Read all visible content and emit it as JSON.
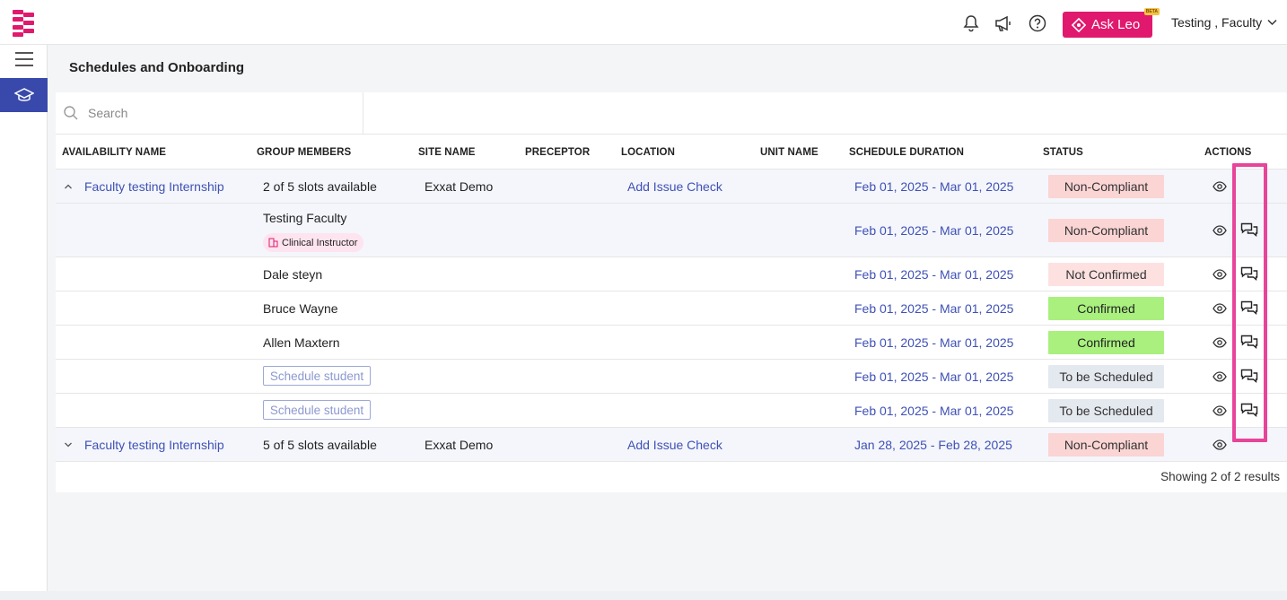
{
  "header": {
    "ask_leo_label": "Ask Leo",
    "beta_label": "BETA",
    "user_name": "Testing , Faculty",
    "icons": [
      "bell-icon",
      "megaphone-icon",
      "help-icon",
      "chevron-down-icon"
    ]
  },
  "page": {
    "title": "Schedules and Onboarding"
  },
  "search": {
    "placeholder": "Search"
  },
  "table": {
    "columns": [
      "AVAILABILITY NAME",
      "GROUP MEMBERS",
      "SITE NAME",
      "PRECEPTOR",
      "LOCATION",
      "UNIT NAME",
      "SCHEDULE DURATION",
      "STATUS",
      "ACTIONS"
    ],
    "rows": [
      {
        "type": "parent",
        "expanded": true,
        "availability": "Faculty testing Internship",
        "members": "2 of 5 slots available",
        "site": "Exxat Demo",
        "preceptor": "",
        "location": "Add Issue Check",
        "unit": "",
        "duration": "Feb 01, 2025 - Mar 01, 2025",
        "status": "Non-Compliant"
      },
      {
        "type": "child",
        "member": "Testing Faculty",
        "role": "Clinical Instructor",
        "duration": "Feb 01, 2025 - Mar 01, 2025",
        "status": "Non-Compliant"
      },
      {
        "type": "child",
        "member": "Dale steyn",
        "duration": "Feb 01, 2025 - Mar 01, 2025",
        "status": "Not Confirmed"
      },
      {
        "type": "child",
        "member": "Bruce Wayne",
        "duration": "Feb 01, 2025 - Mar 01, 2025",
        "status": "Confirmed"
      },
      {
        "type": "child",
        "member": "Allen Maxtern",
        "duration": "Feb 01, 2025 - Mar 01, 2025",
        "status": "Confirmed"
      },
      {
        "type": "child",
        "member_button": "Schedule student",
        "duration": "Feb 01, 2025 - Mar 01, 2025",
        "status": "To be Scheduled"
      },
      {
        "type": "child",
        "member_button": "Schedule student",
        "duration": "Feb 01, 2025 - Mar 01, 2025",
        "status": "To be Scheduled"
      },
      {
        "type": "parent",
        "expanded": false,
        "availability": "Faculty testing Internship",
        "members": "5 of 5 slots available",
        "site": "Exxat Demo",
        "preceptor": "",
        "location": "Add Issue Check",
        "unit": "",
        "duration": "Jan 28, 2025 - Feb 28, 2025",
        "status": "Non-Compliant"
      }
    ]
  },
  "footer": {
    "results": "Showing 2 of 2 results"
  },
  "colors": {
    "brand_pink": "#e0196e",
    "nav_active": "#3949ab",
    "link": "#3f51b5",
    "highlight": "#e7449a",
    "status_non_compliant": "#fbd4d4",
    "status_confirmed": "#a9f07f",
    "status_to_be_scheduled": "#e4e8ef"
  }
}
